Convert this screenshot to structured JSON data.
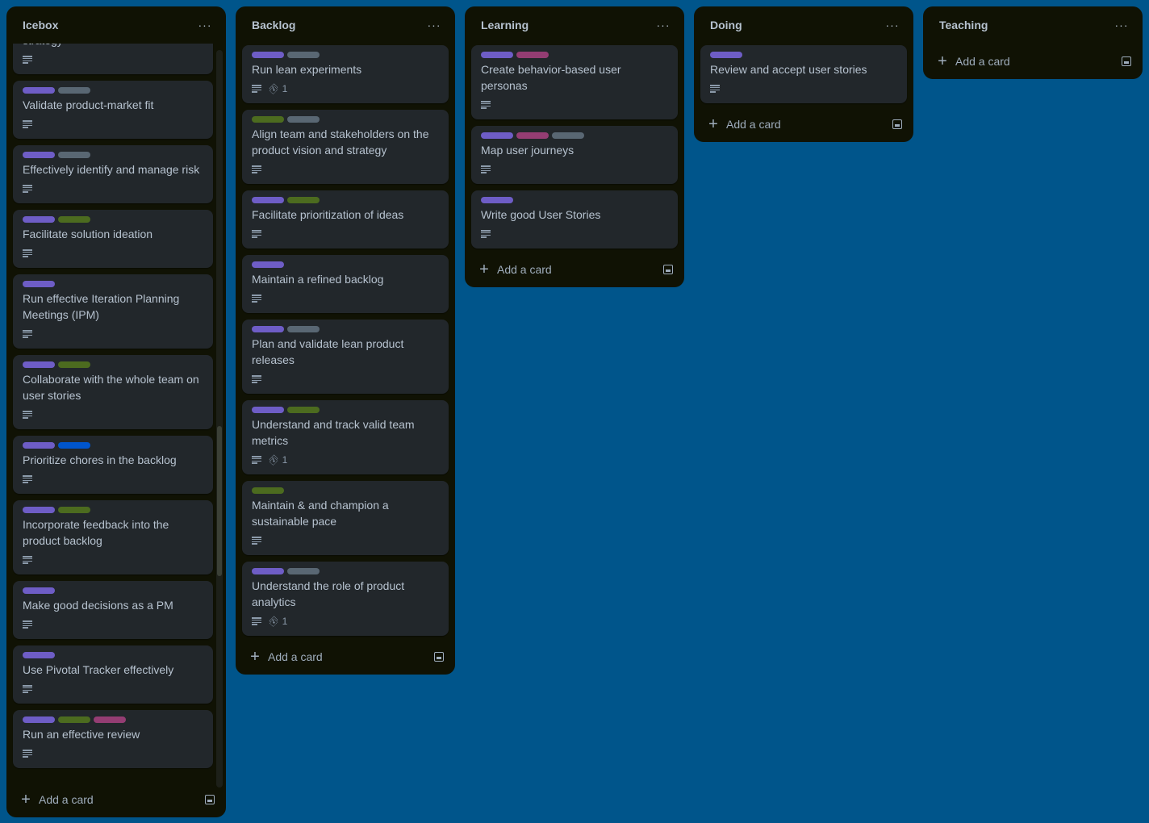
{
  "colors": {
    "background": "#00558b",
    "list_bg": "#101204",
    "card_bg": "#22272b",
    "label_purple": "#6e5dc6",
    "label_gray": "#596773",
    "label_green": "#4c6b1f",
    "label_magenta": "#943d73",
    "label_blue": "#0055cc"
  },
  "board": {
    "lists": [
      {
        "title": "Icebox",
        "more_label": "···",
        "add_card_label": "Add a card",
        "cards": [
          {
            "title": "strategy",
            "labels": [],
            "description": true,
            "attachments": null
          },
          {
            "title": "Validate product-market fit",
            "labels": [
              "purple",
              "gray"
            ],
            "description": true,
            "attachments": null
          },
          {
            "title": "Effectively identify and manage risk",
            "labels": [
              "purple",
              "gray"
            ],
            "description": true,
            "attachments": null
          },
          {
            "title": "Facilitate solution ideation",
            "labels": [
              "purple",
              "green"
            ],
            "description": true,
            "attachments": null
          },
          {
            "title": "Run effective Iteration Planning Meetings (IPM)",
            "labels": [
              "purple"
            ],
            "description": true,
            "attachments": null
          },
          {
            "title": "Collaborate with the whole team on user stories",
            "labels": [
              "purple",
              "green"
            ],
            "description": true,
            "attachments": null
          },
          {
            "title": "Prioritize chores in the backlog",
            "labels": [
              "purple",
              "blue"
            ],
            "description": true,
            "attachments": null
          },
          {
            "title": "Incorporate feedback into the product backlog",
            "labels": [
              "purple",
              "green"
            ],
            "description": true,
            "attachments": null
          },
          {
            "title": "Make good decisions as a PM",
            "labels": [
              "purple"
            ],
            "description": true,
            "attachments": null
          },
          {
            "title": "Use Pivotal Tracker effectively",
            "labels": [
              "purple"
            ],
            "description": true,
            "attachments": null
          },
          {
            "title": "Run an effective review",
            "labels": [
              "purple",
              "green",
              "magenta"
            ],
            "description": true,
            "attachments": null
          }
        ]
      },
      {
        "title": "Backlog",
        "more_label": "···",
        "add_card_label": "Add a card",
        "cards": [
          {
            "title": "Run lean experiments",
            "labels": [
              "purple",
              "gray"
            ],
            "description": true,
            "attachments": "1"
          },
          {
            "title": "Align team and stakeholders on the product vision and strategy",
            "labels": [
              "green",
              "gray"
            ],
            "description": true,
            "attachments": null
          },
          {
            "title": "Facilitate prioritization of ideas",
            "labels": [
              "purple",
              "green"
            ],
            "description": true,
            "attachments": null
          },
          {
            "title": "Maintain a refined backlog",
            "labels": [
              "purple"
            ],
            "description": true,
            "attachments": null
          },
          {
            "title": "Plan and validate lean product releases",
            "labels": [
              "purple",
              "gray"
            ],
            "description": true,
            "attachments": null
          },
          {
            "title": "Understand and track valid team metrics",
            "labels": [
              "purple",
              "green"
            ],
            "description": true,
            "attachments": "1"
          },
          {
            "title": "Maintain & and champion a sustainable pace",
            "labels": [
              "green"
            ],
            "description": true,
            "attachments": null
          },
          {
            "title": "Understand the role of product analytics",
            "labels": [
              "purple",
              "gray"
            ],
            "description": true,
            "attachments": "1"
          }
        ]
      },
      {
        "title": "Learning",
        "more_label": "···",
        "add_card_label": "Add a card",
        "cards": [
          {
            "title": "Create behavior-based user personas",
            "labels": [
              "purple",
              "magenta"
            ],
            "description": true,
            "attachments": null
          },
          {
            "title": "Map user journeys",
            "labels": [
              "purple",
              "magenta",
              "gray"
            ],
            "description": true,
            "attachments": null
          },
          {
            "title": "Write good User Stories",
            "labels": [
              "purple"
            ],
            "description": true,
            "attachments": null
          }
        ]
      },
      {
        "title": "Doing",
        "more_label": "···",
        "add_card_label": "Add a card",
        "cards": [
          {
            "title": "Review and accept user stories",
            "labels": [
              "purple"
            ],
            "description": true,
            "attachments": null
          }
        ]
      },
      {
        "title": "Teaching",
        "more_label": "···",
        "add_card_label": "Add a card",
        "cards": []
      }
    ]
  }
}
